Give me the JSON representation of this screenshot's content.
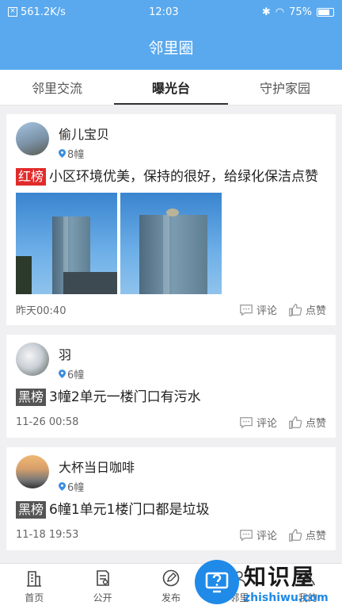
{
  "status_bar": {
    "speed": "561.2K/s",
    "time": "12:03",
    "battery": "75%"
  },
  "header": {
    "title": "邻里圈"
  },
  "tabs": [
    {
      "label": "邻里交流",
      "active": false
    },
    {
      "label": "曝光台",
      "active": true
    },
    {
      "label": "守护家园",
      "active": false
    }
  ],
  "posts": [
    {
      "user": "偷儿宝贝",
      "location": "8幢",
      "badge": "红榜",
      "text": "小区环境优美，保持的很好，给绿化保洁点赞",
      "time": "昨天00:40",
      "comment_label": "评论",
      "like_label": "点赞"
    },
    {
      "user": "羽",
      "location": "6幢",
      "badge": "黑榜",
      "text": "3幢2单元一楼门口有污水",
      "time": "11-26 00:58",
      "comment_label": "评论",
      "like_label": "点赞"
    },
    {
      "user": "大杯当日咖啡",
      "location": "6幢",
      "badge": "黑榜",
      "text": "6幢1单元1楼门口都是垃圾",
      "time": "11-18 19:53",
      "comment_label": "评论",
      "like_label": "点赞"
    }
  ],
  "bottom_nav": [
    {
      "label": "首页",
      "icon": "building-icon"
    },
    {
      "label": "公开",
      "icon": "document-icon"
    },
    {
      "label": "发布",
      "icon": "pen-icon"
    },
    {
      "label": "邻里",
      "icon": "neighbor-icon"
    },
    {
      "label": "我的",
      "icon": "user-icon"
    }
  ],
  "watermark": {
    "title": "知识屋",
    "url": "zhishiwu.com"
  },
  "colors": {
    "primary": "#5aa9ee",
    "red_badge": "#e02b2b",
    "black_badge": "#555555"
  }
}
